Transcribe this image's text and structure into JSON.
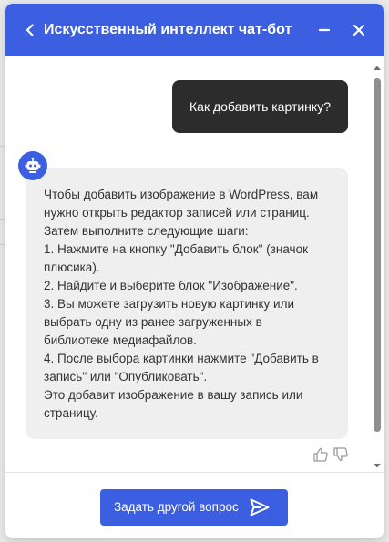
{
  "header": {
    "title": "Искусственный интеллект чат-бот",
    "background_color": "#3b5fe0",
    "back_icon": "chevron-left-icon",
    "minimize_icon": "minimize-icon",
    "close_icon": "close-icon"
  },
  "conversation": {
    "user_message": "Как добавить картинку?",
    "bot_avatar_icon": "robot-icon",
    "bot_message_lines": [
      "Чтобы добавить изображение в WordPress, вам",
      "нужно открыть редактор записей или страниц.",
      "Затем выполните следующие шаги:",
      "1. Нажмите на кнопку \"Добавить блок\" (значок",
      "плюсика).",
      "2. Найдите и выберите блок \"Изображение\".",
      "3. Вы можете загрузить новую картинку или",
      "выбрать одну из ранее загруженных в",
      "библиотеке медиафайлов.",
      "4. После выбора картинки нажмите \"Добавить в",
      "запись\" или \"Опубликовать\".",
      "Это добавит изображение в вашу запись или",
      "страницу."
    ],
    "feedback_icons": [
      "thumbs-up-icon",
      "thumbs-down-icon"
    ]
  },
  "footer": {
    "ask_button_label": "Задать другой вопрос",
    "ask_button_icon": "send-icon",
    "accent_color": "#3b5fe0"
  }
}
